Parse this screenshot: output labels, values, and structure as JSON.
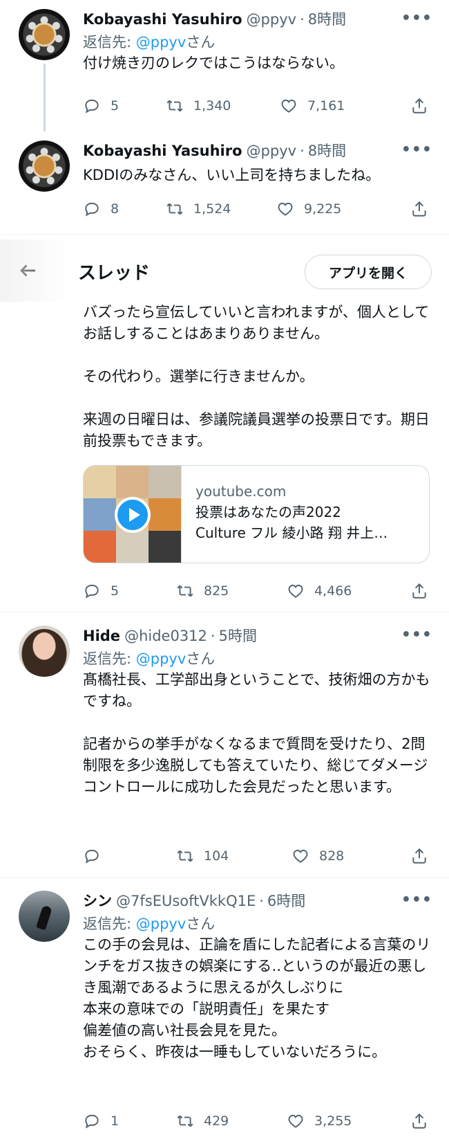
{
  "tweets": [
    {
      "name": "Kobayashi Yasuhiro",
      "handle": "@ppyv",
      "time": "8時間",
      "reply_prefix": "返信先: ",
      "reply_handle": "@ppyv",
      "reply_suffix": "さん",
      "text": "付け焼き刃のレクではこうはならない。",
      "replies": "5",
      "retweets": "1,340",
      "likes": "7,161"
    },
    {
      "name": "Kobayashi Yasuhiro",
      "handle": "@ppyv",
      "time": "8時間",
      "text": "KDDIのみなさん、いい上司を持ちましたね。",
      "replies": "8",
      "retweets": "1,524",
      "likes": "9,225"
    }
  ],
  "thread_header": {
    "title": "スレッド",
    "open_app": "アプリを開く"
  },
  "thread_tweet": {
    "text": "バズったら宣伝していいと言われますが、個人としてお話しすることはあまりありません。\n\nその代わり。選挙に行きませんか。\n\n来週の日曜日は、参議院議員選挙の投票日です。期日前投票もできます。",
    "card_domain": "youtube.com",
    "card_title_1": "投票はあなたの声2022",
    "card_title_2": "Culture フル 綾小路 翔 井上…",
    "replies": "5",
    "retweets": "825",
    "likes": "4,466"
  },
  "replies": [
    {
      "name": "Hide",
      "handle": "@hide0312",
      "time": "5時間",
      "reply_prefix": "返信先: ",
      "reply_handle": "@ppyv",
      "reply_suffix": "さん",
      "text": "髙橋社長、工学部出身ということで、技術畑の方かもですね。\n\n記者からの挙手がなくなるまで質問を受けたり、2問制限を多少逸脱しても答えていたり、総じてダメージコントロールに成功した会見だったと思います。",
      "replies": "",
      "retweets": "104",
      "likes": "828"
    },
    {
      "name": "シン",
      "handle": "@7fsEUsoftVkkQ1E",
      "time": "6時間",
      "reply_prefix": "返信先: ",
      "reply_handle": "@ppyv",
      "reply_suffix": "さん",
      "text": "この手の会見は、正論を盾にした記者による言葉のリンチをガス抜きの娯楽にする‥というのが最近の悪しき風潮であるように思えるが久しぶりに\n本来の意味での「説明責任」を果たす\n偏差値の高い社長会見を見た。\nおそらく、昨夜は一睡もしていないだろうに。",
      "replies": "1",
      "retweets": "429",
      "likes": "3,255"
    }
  ],
  "icons": {
    "reply": "reply-icon",
    "retweet": "retweet-icon",
    "like": "heart-icon",
    "share": "share-icon",
    "more": "more-icon",
    "back": "back-arrow-icon"
  },
  "colors": {
    "link": "#1d9bf0",
    "muted": "#536471",
    "text": "#0f1419",
    "divider": "#eff3f4"
  }
}
